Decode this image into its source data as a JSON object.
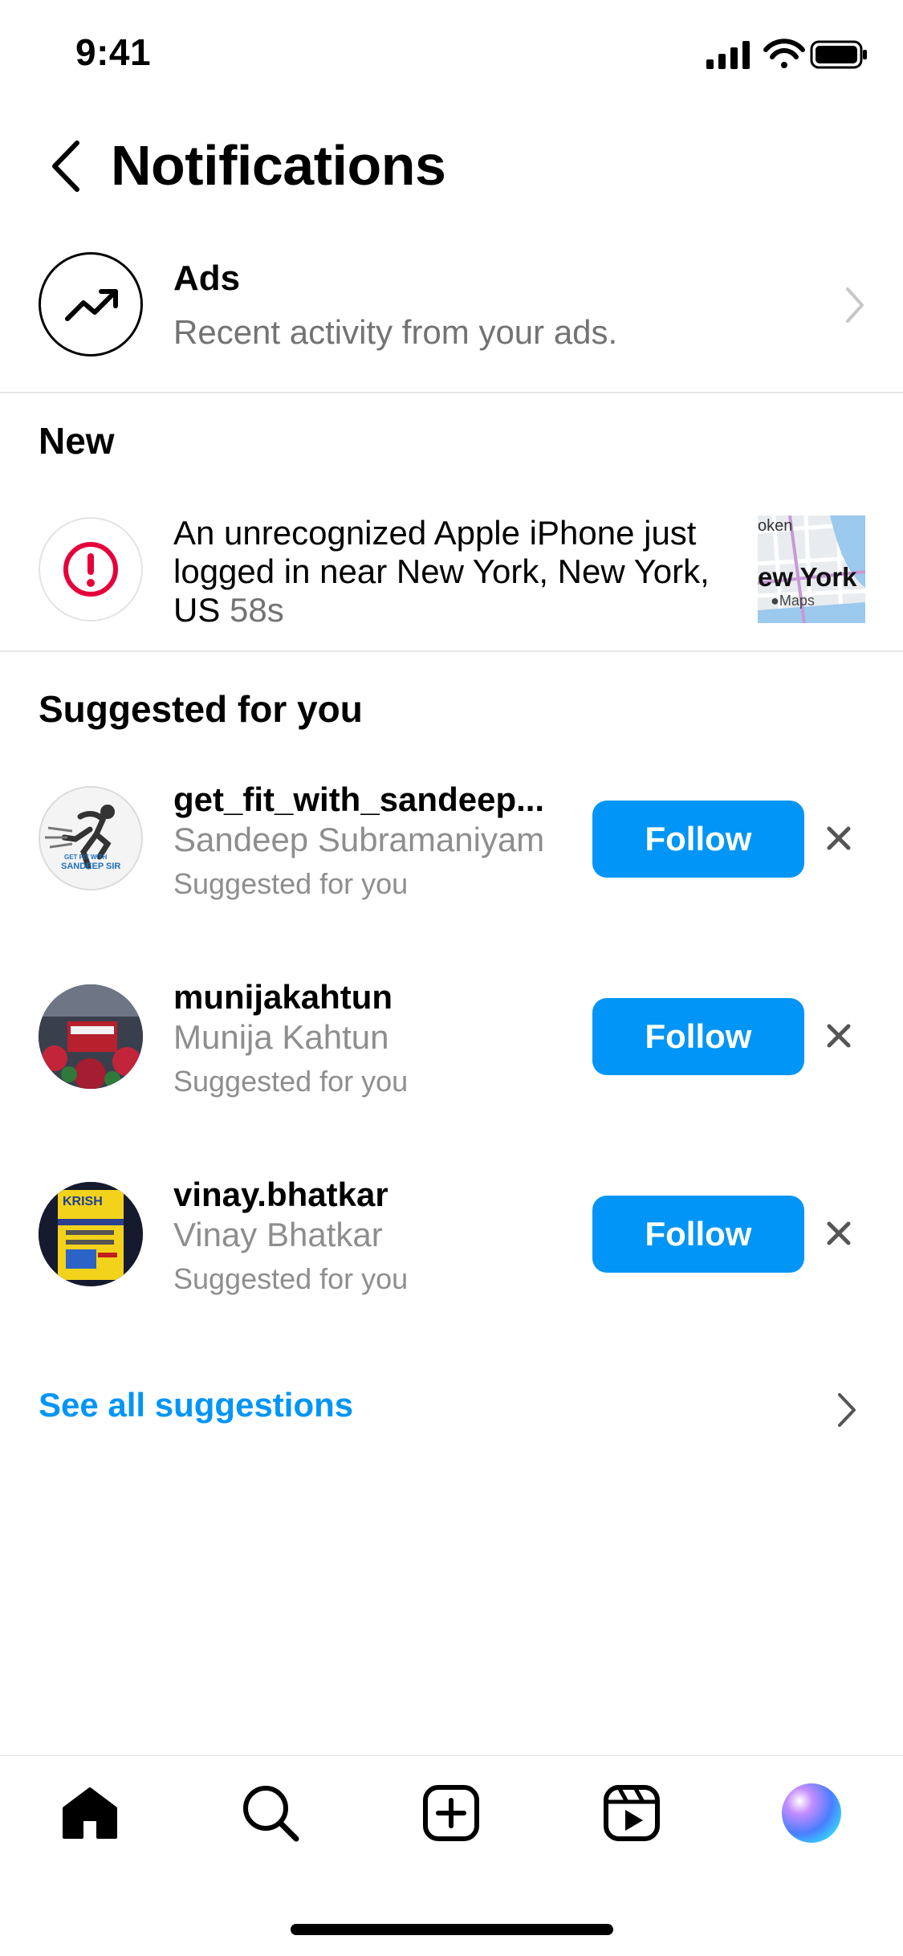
{
  "status_bar": {
    "time": "9:41"
  },
  "header": {
    "title": "Notifications"
  },
  "ads": {
    "title": "Ads",
    "subtitle": "Recent activity from your ads."
  },
  "new_section": {
    "title": "New",
    "alert": {
      "message": "An unrecognized Apple iPhone just logged in near New York, New York, US",
      "time": "58s",
      "map_label": "ew York",
      "map_top_label": "oken",
      "map_brand": "Maps"
    }
  },
  "suggested_section": {
    "title": "Suggested for you",
    "items": [
      {
        "username": "get_fit_with_sandeep...",
        "name": "Sandeep Subramaniyam",
        "subtitle": "Suggested for you",
        "button": "Follow",
        "avatar_text_top": "GET FIT WITH",
        "avatar_text_bottom": "SANDEEP SIR"
      },
      {
        "username": "munijakahtun",
        "name": "Munija Kahtun",
        "subtitle": "Suggested for you",
        "button": "Follow"
      },
      {
        "username": "vinay.bhatkar",
        "name": "Vinay Bhatkar",
        "subtitle": "Suggested for you",
        "button": "Follow",
        "avatar_text_top": "KRISH"
      }
    ],
    "see_all": "See all suggestions"
  },
  "tab_bar": {
    "tabs": [
      "home-icon",
      "search-icon",
      "create-icon",
      "reels-icon",
      "profile-avatar"
    ]
  },
  "colors": {
    "accent": "#0095f6",
    "alert_red": "#e6003a",
    "muted": "#737373"
  }
}
